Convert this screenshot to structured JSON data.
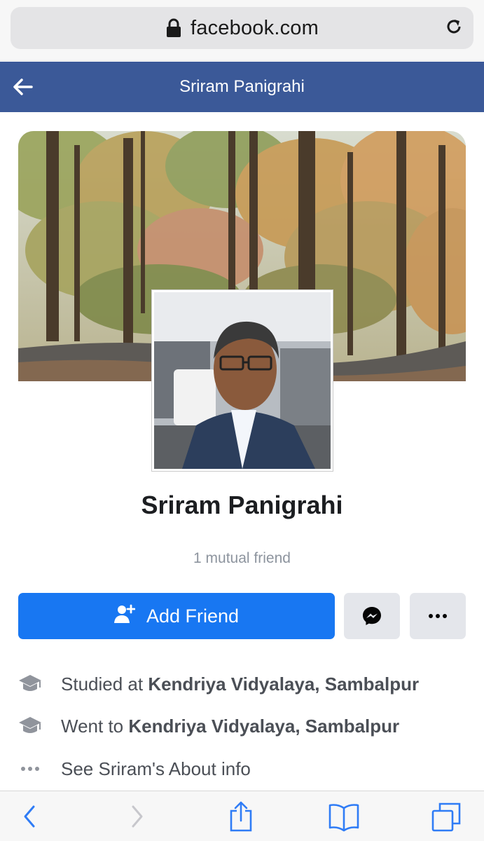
{
  "browser": {
    "url": "facebook.com",
    "icons": {
      "lock": "lock-icon",
      "reload": "reload-icon"
    }
  },
  "header": {
    "title": "Sriram Panigrahi",
    "back_icon": "arrow-left-icon",
    "background": "#3b5998"
  },
  "profile": {
    "name": "Sriram Panigrahi",
    "mutual_friends": "1 mutual friend"
  },
  "actions": {
    "add_friend_label": "Add Friend",
    "add_friend_color": "#1877f2",
    "messenger_icon": "messenger-icon",
    "more_icon": "more-horizontal-icon"
  },
  "info": [
    {
      "icon": "graduation-cap-icon",
      "prefix": "Studied at ",
      "bold": "Kendriya Vidyalaya, Sambalpur"
    },
    {
      "icon": "graduation-cap-icon",
      "prefix": "Went to ",
      "bold": "Kendriya Vidyalaya, Sambalpur"
    },
    {
      "icon": "more-horizontal-icon",
      "prefix": "See Sriram's About info",
      "bold": ""
    }
  ],
  "toolbar": {
    "items": [
      "back-icon",
      "forward-icon",
      "share-icon",
      "bookmarks-icon",
      "tabs-icon"
    ]
  }
}
